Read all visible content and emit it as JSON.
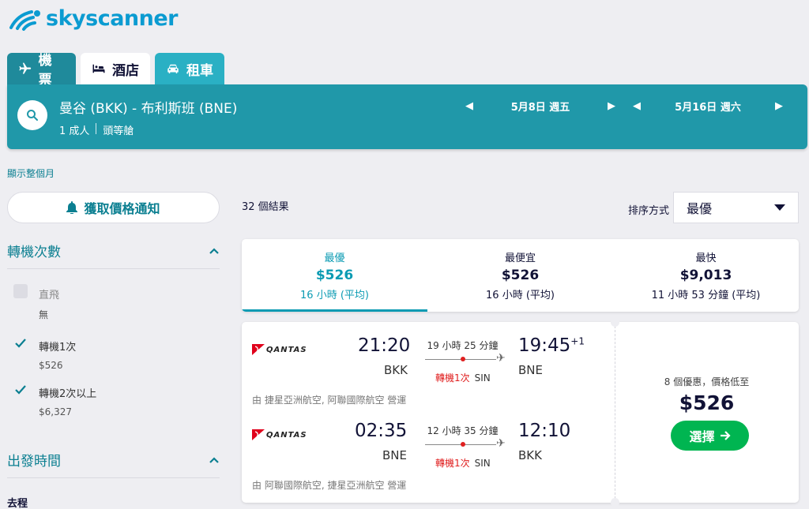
{
  "logo": {
    "text": "skyscanner"
  },
  "tabs": [
    {
      "label": "機票",
      "icon": "plane-icon"
    },
    {
      "label": "酒店",
      "icon": "bed-icon"
    },
    {
      "label": "租車",
      "icon": "car-icon"
    }
  ],
  "search": {
    "route": "曼谷 (BKK) - 布利斯班 (BNE)",
    "passengers": "1 成人",
    "cabin": "頭等艙",
    "depart_date": "5月8日 週五",
    "return_date": "5月16日 週六"
  },
  "show_month": "顯示整個月",
  "price_alert": "獲取價格通知",
  "filters": {
    "stops_title": "轉機次數",
    "options": [
      {
        "label": "直飛",
        "sub": "無",
        "checked": false,
        "disabled": true
      },
      {
        "label": "轉機1次",
        "sub": "$526",
        "checked": true,
        "disabled": false
      },
      {
        "label": "轉機2次以上",
        "sub": "$6,327",
        "checked": true,
        "disabled": false
      }
    ],
    "departure_title": "出發時間",
    "outbound_label": "去程"
  },
  "results": {
    "count": "32 個結果",
    "sort_label": "排序方式",
    "sort_value": "最優"
  },
  "summary": [
    {
      "title": "最優",
      "price": "$526",
      "detail": "16 小時 (平均)",
      "active": true
    },
    {
      "title": "最便宜",
      "price": "$526",
      "detail": "16 小時 (平均)",
      "active": false
    },
    {
      "title": "最快",
      "price": "$9,013",
      "detail": "11 小時 53 分鐘 (平均)",
      "active": false
    }
  ],
  "card": {
    "legs": [
      {
        "airline": "QANTAS",
        "dep_time": "21:20",
        "dep_code": "BKK",
        "duration": "19 小時 25 分鐘",
        "stops": "轉機1次",
        "via": "SIN",
        "arr_time": "19:45",
        "arr_plus": "+1",
        "arr_code": "BNE",
        "operated": "由 捷星亞洲航空, 阿聯國際航空 營運"
      },
      {
        "airline": "QANTAS",
        "dep_time": "02:35",
        "dep_code": "BNE",
        "duration": "12 小時 35 分鐘",
        "stops": "轉機1次",
        "via": "SIN",
        "arr_time": "12:10",
        "arr_plus": "",
        "arr_code": "BKK",
        "operated": "由 阿聯國際航空, 捷星亞洲航空 營運"
      }
    ],
    "deals_text": "8 個優惠，價格低至",
    "price": "$526",
    "select_label": "選擇"
  },
  "colors": {
    "brand_teal": "#2098a9",
    "accent_link": "#0b7f91",
    "stops_red": "#e02020",
    "select_green": "#00b551"
  }
}
